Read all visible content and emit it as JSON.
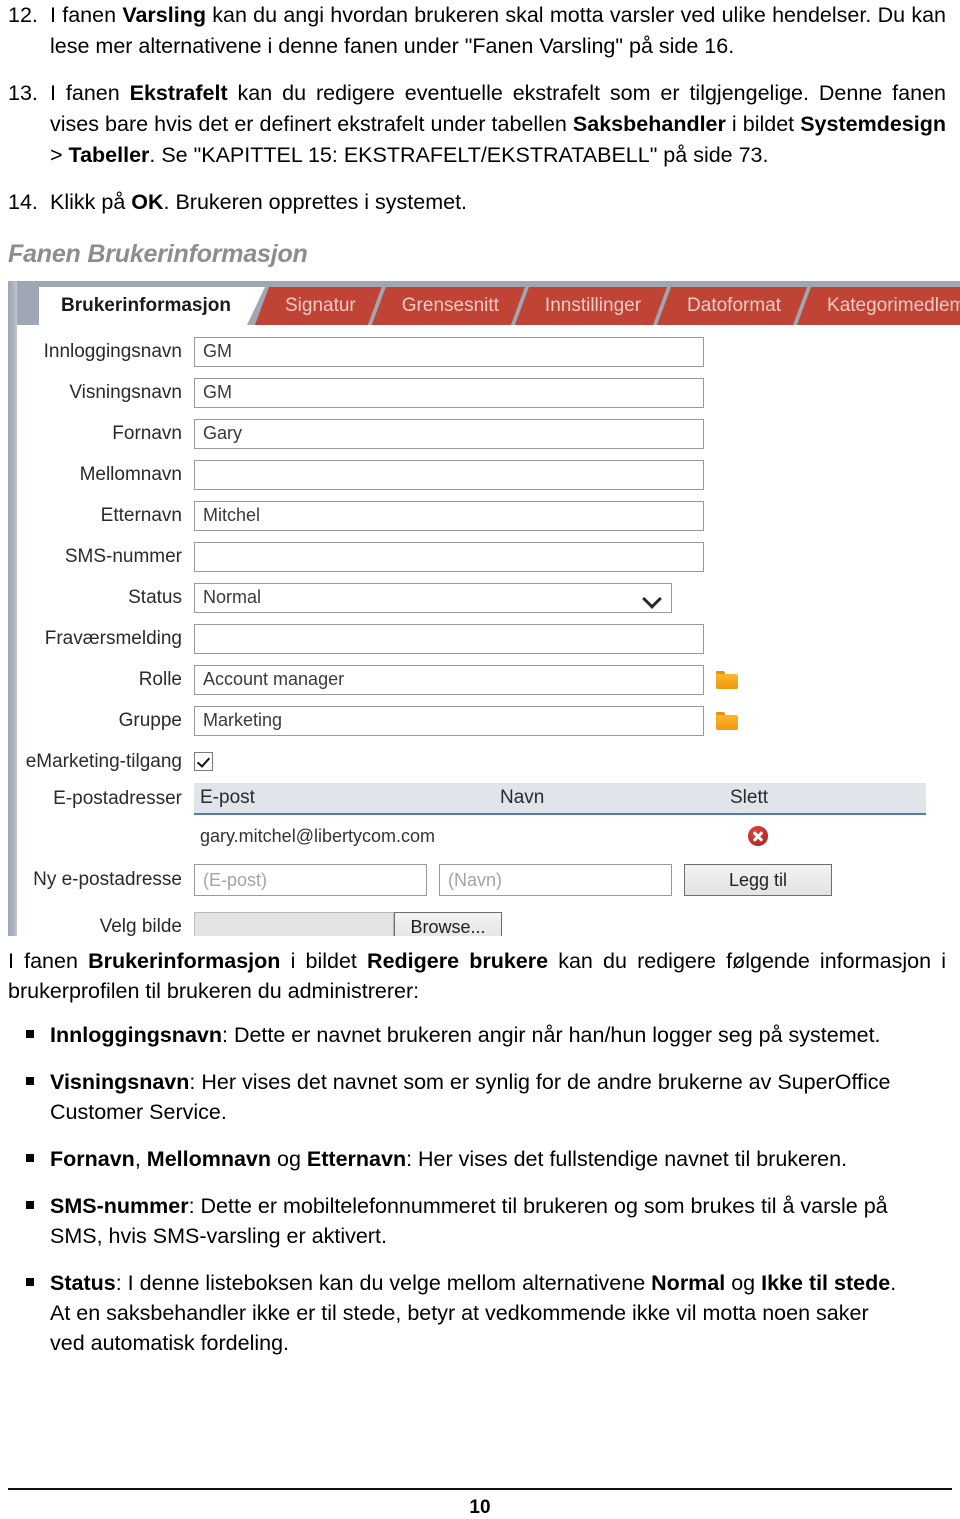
{
  "numbered_items": [
    {
      "number": "12.",
      "parts": [
        {
          "t": "I fanen ",
          "b": false
        },
        {
          "t": "Varsling",
          "b": true
        },
        {
          "t": " kan du angi hvordan brukeren skal motta varsler ved ulike hendelser. Du kan lese mer alternativene i denne fanen under \"Fanen Varsling\" på side 16.",
          "b": false
        }
      ]
    },
    {
      "number": "13.",
      "parts": [
        {
          "t": "I fanen ",
          "b": false
        },
        {
          "t": "Ekstrafelt",
          "b": true
        },
        {
          "t": " kan du redigere eventuelle ekstrafelt som er tilgjengelige. Denne fanen vises bare hvis det er definert ekstrafelt under tabellen ",
          "b": false
        },
        {
          "t": "Saksbehandler",
          "b": true
        },
        {
          "t": " i bildet ",
          "b": false
        },
        {
          "t": "Systemdesign",
          "b": true
        },
        {
          "t": " > ",
          "b": false
        },
        {
          "t": "Tabeller",
          "b": true
        },
        {
          "t": ". Se \"KAPITTEL 15: EKSTRAFELT/EKSTRATABELL\" på side 73.",
          "b": false
        }
      ]
    },
    {
      "number": "14.",
      "parts": [
        {
          "t": "Klikk på ",
          "b": false
        },
        {
          "t": "OK",
          "b": true
        },
        {
          "t": ". Brukeren opprettes i systemet.",
          "b": false
        }
      ]
    }
  ],
  "section_heading": "Fanen Brukerinformasjon",
  "app": {
    "tabs": [
      {
        "label": "Brukerinformasjon",
        "active": true
      },
      {
        "label": "Signatur",
        "active": false
      },
      {
        "label": "Grensesnitt",
        "active": false
      },
      {
        "label": "Innstillinger",
        "active": false
      },
      {
        "label": "Datoformat",
        "active": false
      },
      {
        "label": "Kategorimedlem",
        "active": false
      }
    ],
    "fields": {
      "innloggingsnavn_label": "Innloggingsnavn",
      "innloggingsnavn_value": "GM",
      "visningsnavn_label": "Visningsnavn",
      "visningsnavn_value": "GM",
      "fornavn_label": "Fornavn",
      "fornavn_value": "Gary",
      "mellomnavn_label": "Mellomnavn",
      "mellomnavn_value": "",
      "etternavn_label": "Etternavn",
      "etternavn_value": "Mitchel",
      "sms_label": "SMS-nummer",
      "sms_value": "",
      "status_label": "Status",
      "status_value": "Normal",
      "status_options": [
        "Normal",
        "Ikke til stede"
      ],
      "fravaer_label": "Fraværsmelding",
      "fravaer_value": "",
      "rolle_label": "Rolle",
      "rolle_value": "Account manager",
      "gruppe_label": "Gruppe",
      "gruppe_value": "Marketing",
      "emarketing_label": "eMarketing-tilgang",
      "emarketing_checked": true,
      "epostadresser_label": "E-postadresser",
      "ny_epostadresse_label": "Ny e-postadresse",
      "velg_bilde_label": "Velg bilde"
    },
    "email_table": {
      "headers": [
        "E-post",
        "Navn",
        "Slett"
      ],
      "rows": [
        {
          "epost": "gary.mitchel@libertycom.com",
          "navn": ""
        }
      ]
    },
    "new_email": {
      "epost_placeholder": "(E-post)",
      "navn_placeholder": "(Navn)",
      "add_label": "Legg til"
    },
    "browse": {
      "file_value": "",
      "button_label": "Browse..."
    },
    "colors": {
      "tab_red": "#bf4436",
      "tab_red_text": "#f4c9c3",
      "chrome_gray": "#9ea7b3",
      "folder_orange": "#f0980d",
      "delete_red": "#b52722",
      "table_header_bg": "#dfe5ea",
      "table_header_rule": "#4f7fa8"
    }
  },
  "body_copy": {
    "intro_parts": [
      {
        "t": "I fanen ",
        "b": false
      },
      {
        "t": "Brukerinformasjon",
        "b": true
      },
      {
        "t": " i bildet ",
        "b": false
      },
      {
        "t": "Redigere brukere",
        "b": true
      },
      {
        "t": " kan du redigere følgende informasjon i brukerprofilen til brukeren du administrerer:",
        "b": false
      }
    ],
    "bullets": [
      {
        "parts": [
          {
            "t": "Innloggingsnavn",
            "b": true
          },
          {
            "t": ": Dette er navnet brukeren angir når han/hun logger seg på systemet.",
            "b": false
          }
        ]
      },
      {
        "parts": [
          {
            "t": "Visningsnavn",
            "b": true
          },
          {
            "t": ": Her vises det navnet som er synlig for de andre brukerne av SuperOffice Customer Service.",
            "b": false
          }
        ]
      },
      {
        "parts": [
          {
            "t": "Fornavn",
            "b": true
          },
          {
            "t": ", ",
            "b": false
          },
          {
            "t": "Mellomnavn",
            "b": true
          },
          {
            "t": " og ",
            "b": false
          },
          {
            "t": "Etternavn",
            "b": true
          },
          {
            "t": ": Her vises det fullstendige navnet til brukeren.",
            "b": false
          }
        ]
      },
      {
        "parts": [
          {
            "t": "SMS-nummer",
            "b": true
          },
          {
            "t": ": Dette er mobiltelefonnummeret til brukeren og som brukes til å varsle på SMS, hvis SMS-varsling er aktivert.",
            "b": false
          }
        ]
      },
      {
        "parts": [
          {
            "t": "Status",
            "b": true
          },
          {
            "t": ": I denne listeboksen kan du velge mellom alternativene ",
            "b": false
          },
          {
            "t": "Normal",
            "b": true
          },
          {
            "t": " og ",
            "b": false
          },
          {
            "t": "Ikke til stede",
            "b": true
          },
          {
            "t": ". At en saksbehandler ikke er til stede, betyr at vedkommende ikke vil motta noen saker ved automatisk fordeling.",
            "b": false
          }
        ]
      }
    ]
  },
  "footer": {
    "page_number": "10"
  }
}
